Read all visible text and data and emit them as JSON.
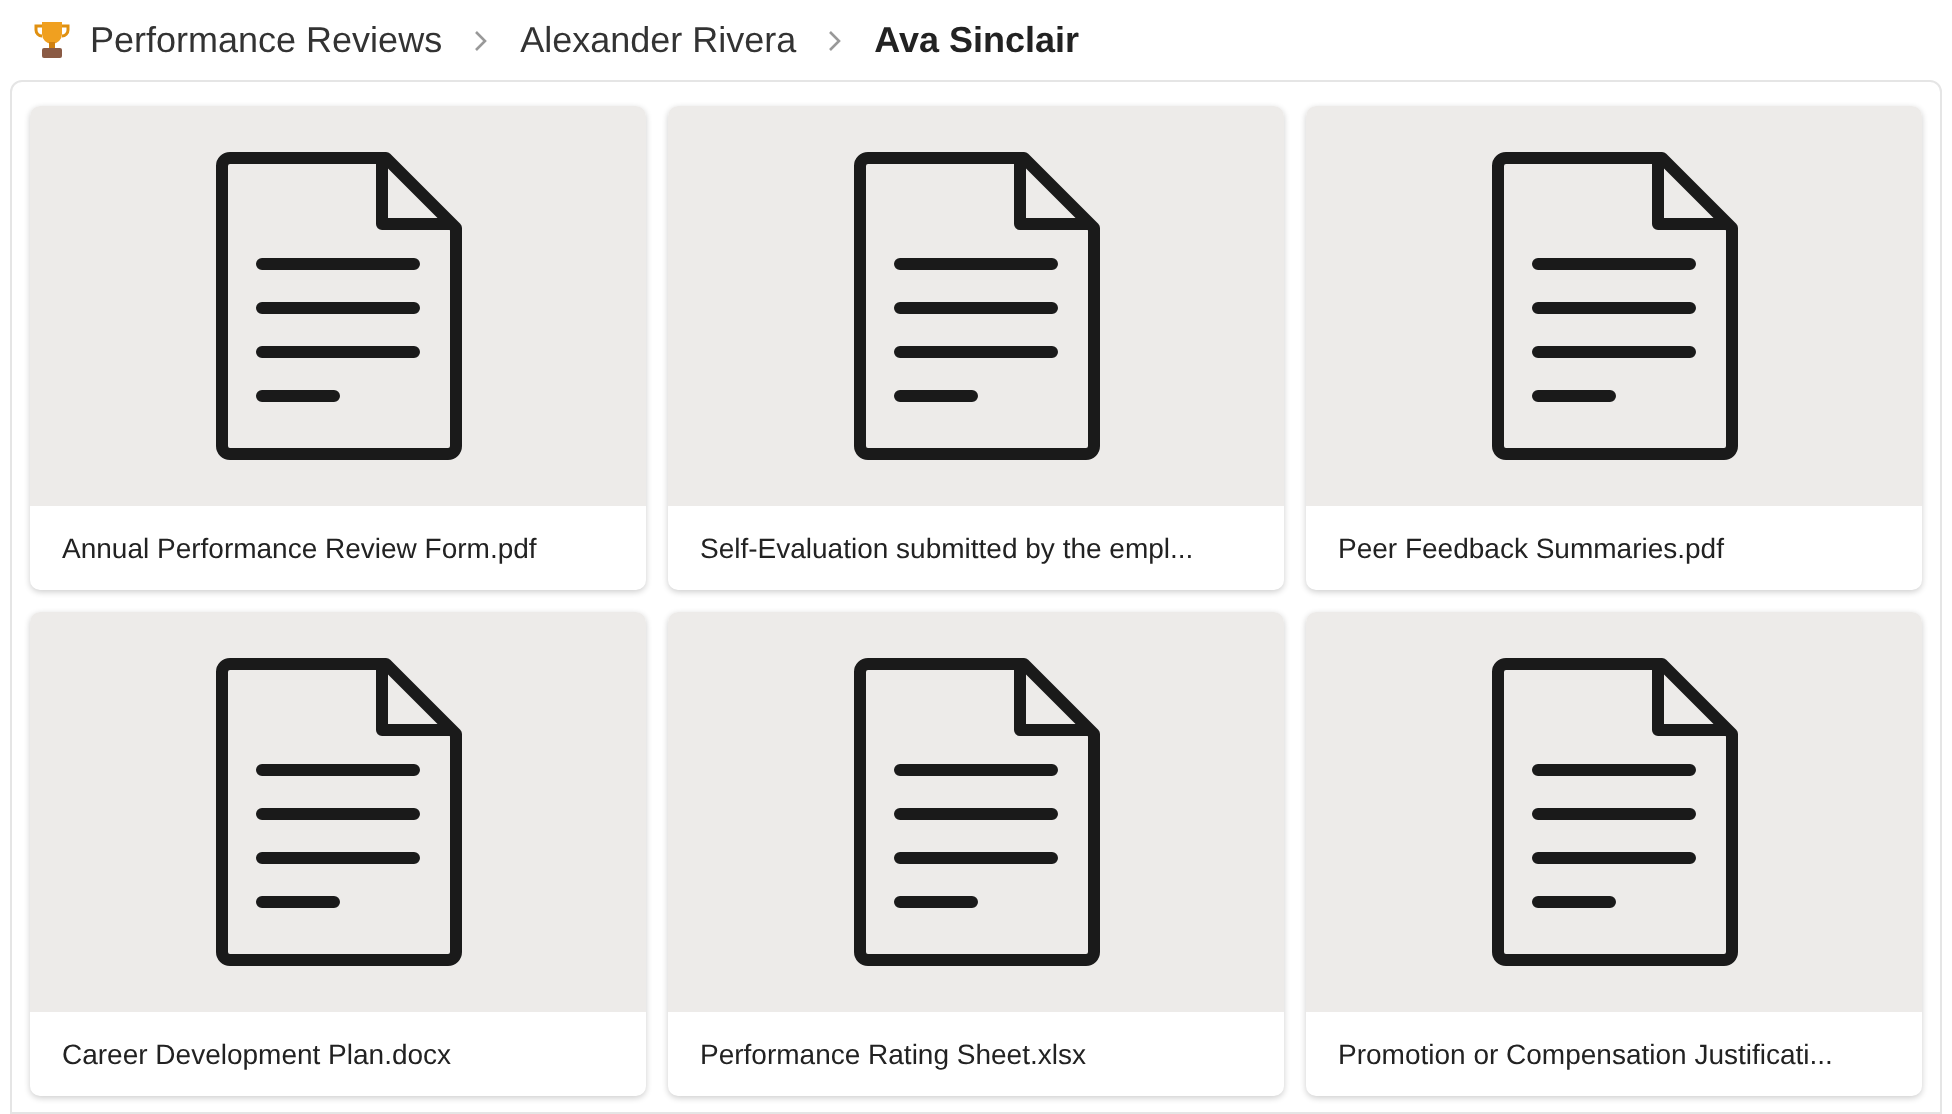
{
  "breadcrumb": [
    {
      "label": "Performance Reviews",
      "current": false
    },
    {
      "label": "Alexander Rivera",
      "current": false
    },
    {
      "label": "Ava Sinclair",
      "current": true
    }
  ],
  "files": [
    {
      "name": "Annual Performance Review Form.pdf"
    },
    {
      "name": "Self-Evaluation submitted by the empl..."
    },
    {
      "name": "Peer Feedback Summaries.pdf"
    },
    {
      "name": "Career Development Plan.docx"
    },
    {
      "name": "Performance Rating Sheet.xlsx"
    },
    {
      "name": "Promotion or Compensation Justificati..."
    }
  ]
}
